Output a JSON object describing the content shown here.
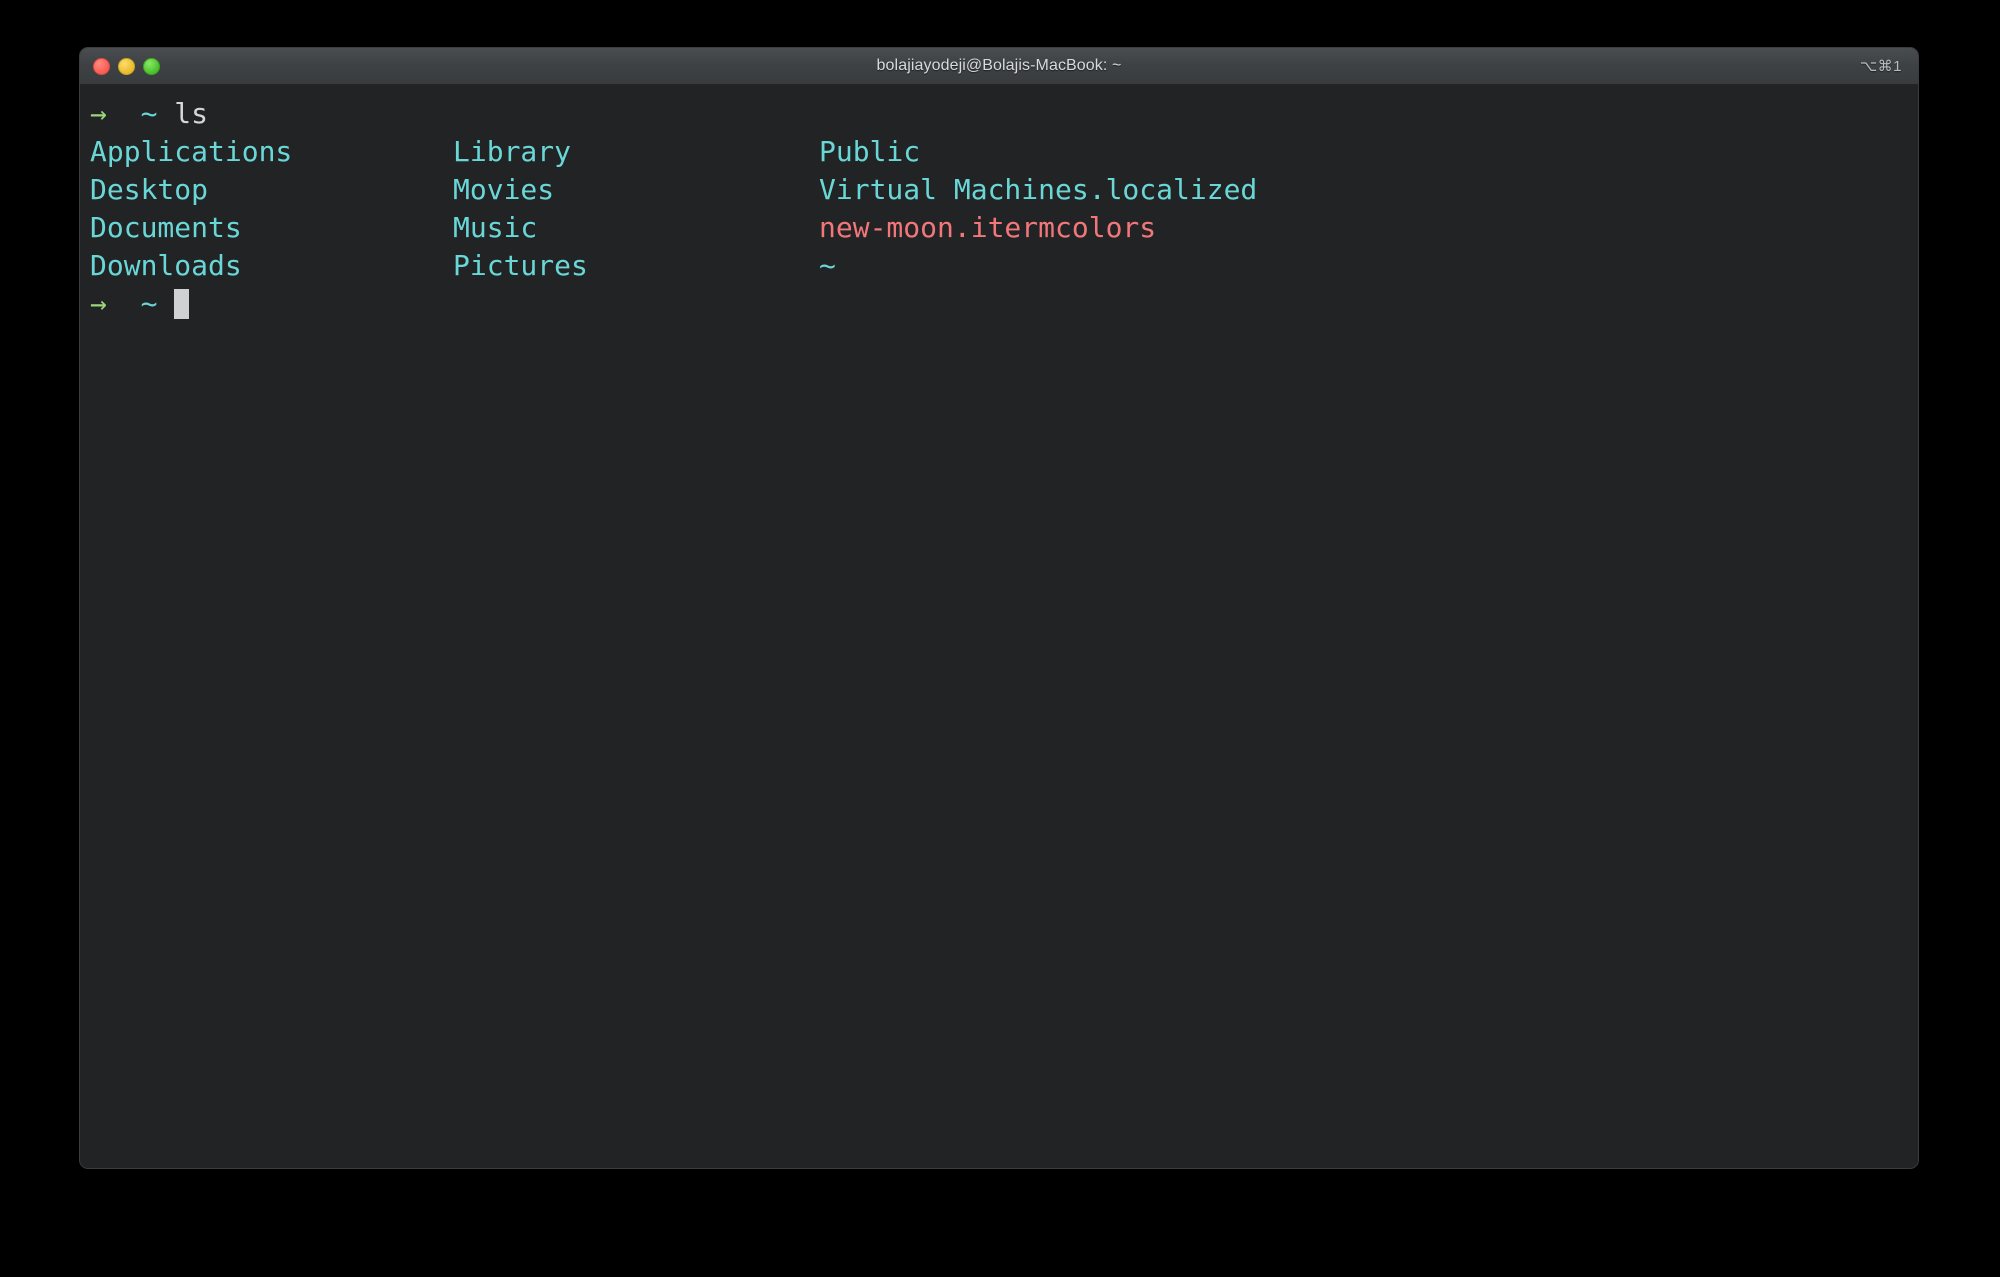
{
  "window": {
    "title": "bolajiayodeji@Bolajis-MacBook: ~",
    "shortcut": "⌥⌘1",
    "traffic_lights": {
      "close_label": "close",
      "minimize_label": "minimize",
      "maximize_label": "maximize"
    },
    "colors": {
      "titlebar_bg": "#3e4144",
      "terminal_bg": "#222325",
      "cyan": "#6ad7d7",
      "green": "#9bd47b",
      "white": "#d4d6d7",
      "red": "#f2777a",
      "cursor": "#cfd1d2",
      "close_dot": "#fb5b52",
      "minimize_dot": "#e8bb2b",
      "maximize_dot": "#48c128"
    }
  },
  "terminal": {
    "prompt": {
      "arrow": "→",
      "path": "~",
      "command": "ls"
    },
    "rows": [
      {
        "col1": "Applications",
        "col2": "Library",
        "col3": "Public"
      },
      {
        "col1": "Desktop",
        "col2": "Movies",
        "col3": "Virtual Machines.localized"
      },
      {
        "col1": "Documents",
        "col2": "Music",
        "col3": "new-moon.itermcolors"
      },
      {
        "col1": "Downloads",
        "col2": "Pictures",
        "col3": "~"
      }
    ],
    "row_colors": [
      {
        "col1": "cyan",
        "col2": "cyan",
        "col3": "cyan"
      },
      {
        "col1": "cyan",
        "col2": "cyan",
        "col3": "cyan"
      },
      {
        "col1": "cyan",
        "col2": "cyan",
        "col3": "red"
      },
      {
        "col1": "cyan",
        "col2": "cyan",
        "col3": "cyan"
      }
    ],
    "final_prompt": {
      "arrow": "→",
      "path": "~",
      "command": ""
    }
  }
}
